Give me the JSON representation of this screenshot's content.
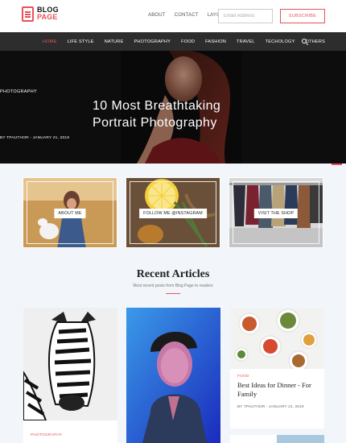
{
  "logo": {
    "line1": "BLOG",
    "line2": "PAGE"
  },
  "topnav": [
    "ABOUT",
    "CONTACT",
    "LAYOUT"
  ],
  "subscribe": {
    "placeholder": "Email Address",
    "button": "SUBSCRIBE"
  },
  "nav": {
    "items": [
      "HOME",
      "LIFE STYLE",
      "NATURE",
      "PHOTOGRAPHY",
      "FOOD",
      "FASHION",
      "TRAVEL",
      "TECHOLOGY",
      "OTHERS"
    ],
    "active": "HOME",
    "search_icon": "search-icon"
  },
  "hero": {
    "category": "PHOTOGRAPHY",
    "title": "10 Most Breathtaking Portrait Photography",
    "meta": "BY TPAUTHOR - JANUARY 21, 2019"
  },
  "features": [
    {
      "label": "ABOUT ME"
    },
    {
      "label": "FOLLOW ME @INSTAGRAM"
    },
    {
      "label": "VISIT THE SHOP"
    }
  ],
  "recent": {
    "title": "Recent Articles",
    "subtitle": "Most recent posts from Blog Page to readers"
  },
  "cards": [
    {
      "category": "PHOTOGRAPHY"
    },
    {
      "category": ""
    },
    {
      "category": "FOOD",
      "title": "Best Ideas for Dinner - For Family",
      "meta": "BY TPAUTHOR - JANUARY 21, 2019"
    }
  ],
  "colors": {
    "accent": "#e8525a",
    "nav_bg": "#2d2d2d",
    "band_bg": "#f2f6fa"
  }
}
